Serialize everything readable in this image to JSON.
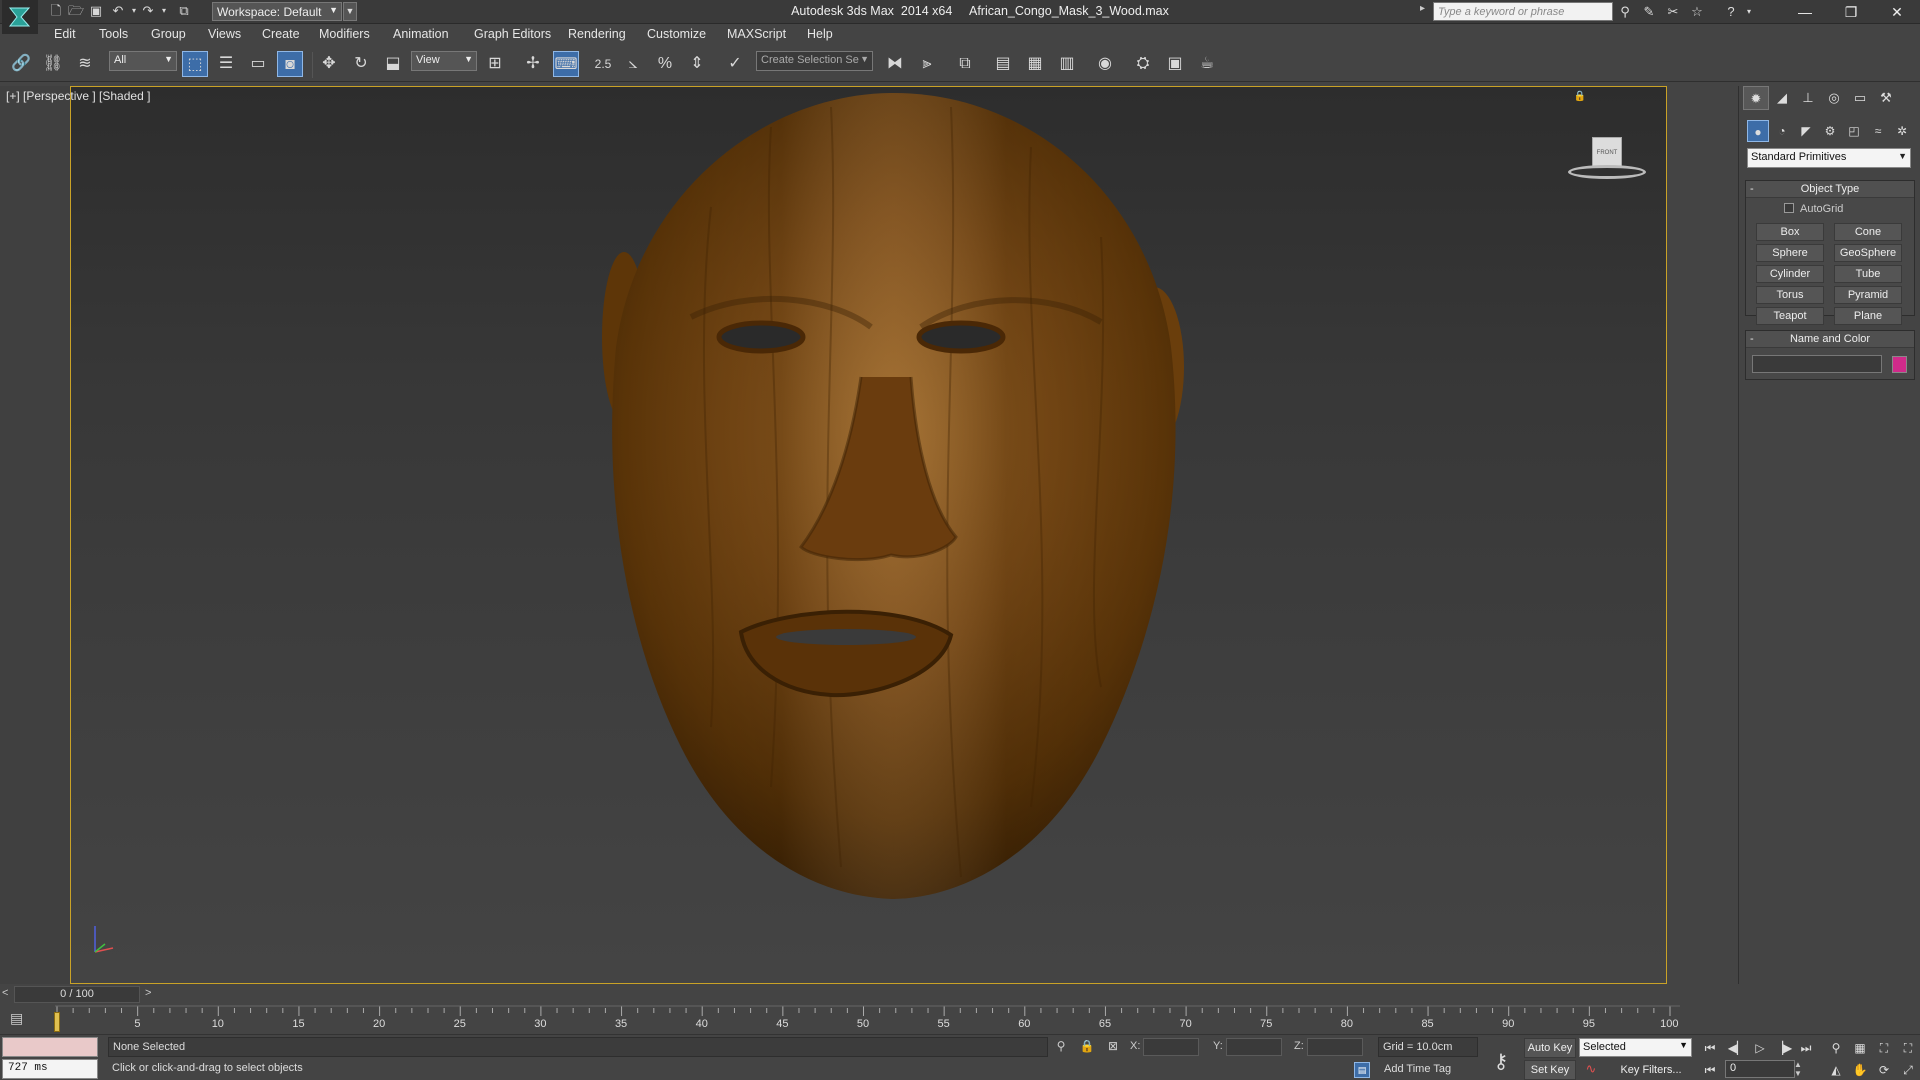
{
  "titlebar": {
    "workspace_label": "Workspace: Default",
    "app_name": "Autodesk 3ds Max  2014 x64",
    "file_name": "African_Congo_Mask_3_Wood.max",
    "search_placeholder": "Type a keyword or phrase"
  },
  "menu": [
    "Edit",
    "Tools",
    "Group",
    "Views",
    "Create",
    "Modifiers",
    "Animation",
    "Graph Editors",
    "Rendering",
    "Customize",
    "MAXScript",
    "Help"
  ],
  "toolbar": {
    "filter_value": "All",
    "refcoord_value": "View",
    "snap_value": "2.5",
    "angle_snap_value": "%",
    "selection_set_placeholder": "Create Selection Se"
  },
  "viewport": {
    "label": "[+] [Perspective ] [Shaded ]",
    "viewcube_face": "FRONT",
    "mask_color": "#7a4a14",
    "border_color": "#c9a227"
  },
  "command_panel": {
    "primitive_type": "Standard Primitives",
    "object_type_title": "Object Type",
    "autogrid_label": "AutoGrid",
    "object_buttons": [
      "Box",
      "Cone",
      "Sphere",
      "GeoSphere",
      "Cylinder",
      "Tube",
      "Torus",
      "Pyramid",
      "Teapot",
      "Plane"
    ],
    "name_color_title": "Name and Color",
    "object_color": "#d02a8a"
  },
  "timeline": {
    "frame_display": "0 / 100",
    "tick_labels": [
      "5",
      "10",
      "15",
      "20",
      "25",
      "30",
      "35",
      "40",
      "45",
      "50",
      "55",
      "60",
      "65",
      "70",
      "75",
      "80",
      "85",
      "90",
      "95",
      "100"
    ]
  },
  "status": {
    "timing": "727 ms",
    "selection": "None Selected",
    "prompt": "Click or click-and-drag to select objects",
    "x_label": "X:",
    "y_label": "Y:",
    "z_label": "Z:",
    "grid": "Grid = 10.0cm",
    "add_time_tag": "Add Time Tag",
    "auto_key": "Auto Key",
    "set_key": "Set Key",
    "selected_value": "Selected",
    "key_filters": "Key Filters...",
    "current_frame": "0"
  }
}
